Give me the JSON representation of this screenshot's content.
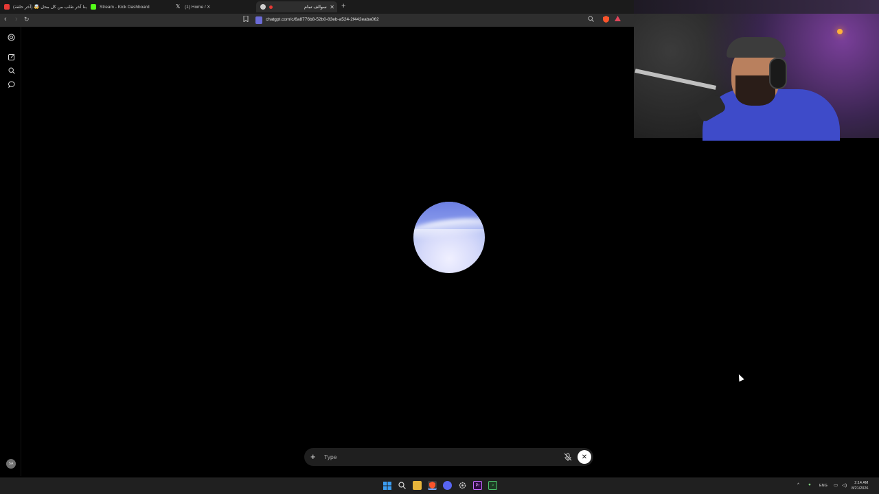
{
  "browser": {
    "tabs": [
      {
        "label": "جربنا آخر طلب من كل محل 🤯 (آخر حلقة)",
        "favicon_color": "#e53935"
      },
      {
        "label": "Stream - Kick Dashboard",
        "favicon_color": "#53fc18"
      },
      {
        "label": "(1) Home / X",
        "favicon_color": "#ffffff"
      },
      {
        "label": "سوالف تمام",
        "favicon_color": "#cfcfcf",
        "active": true
      }
    ],
    "url": "chatgpt.com/c/6a8776b8-52b0-83eb-a524-2f442eaba062"
  },
  "sidebar": {
    "avatar_initials": "SA"
  },
  "composer": {
    "placeholder": "Type"
  },
  "taskbar": {
    "language": "ENG",
    "time": "2:14 AM",
    "date": "8/21/2026"
  },
  "colors": {
    "accent_brave": "#fb542b",
    "orb_top": "#6c7fe2",
    "orb_bottom": "#f0f0ff"
  }
}
